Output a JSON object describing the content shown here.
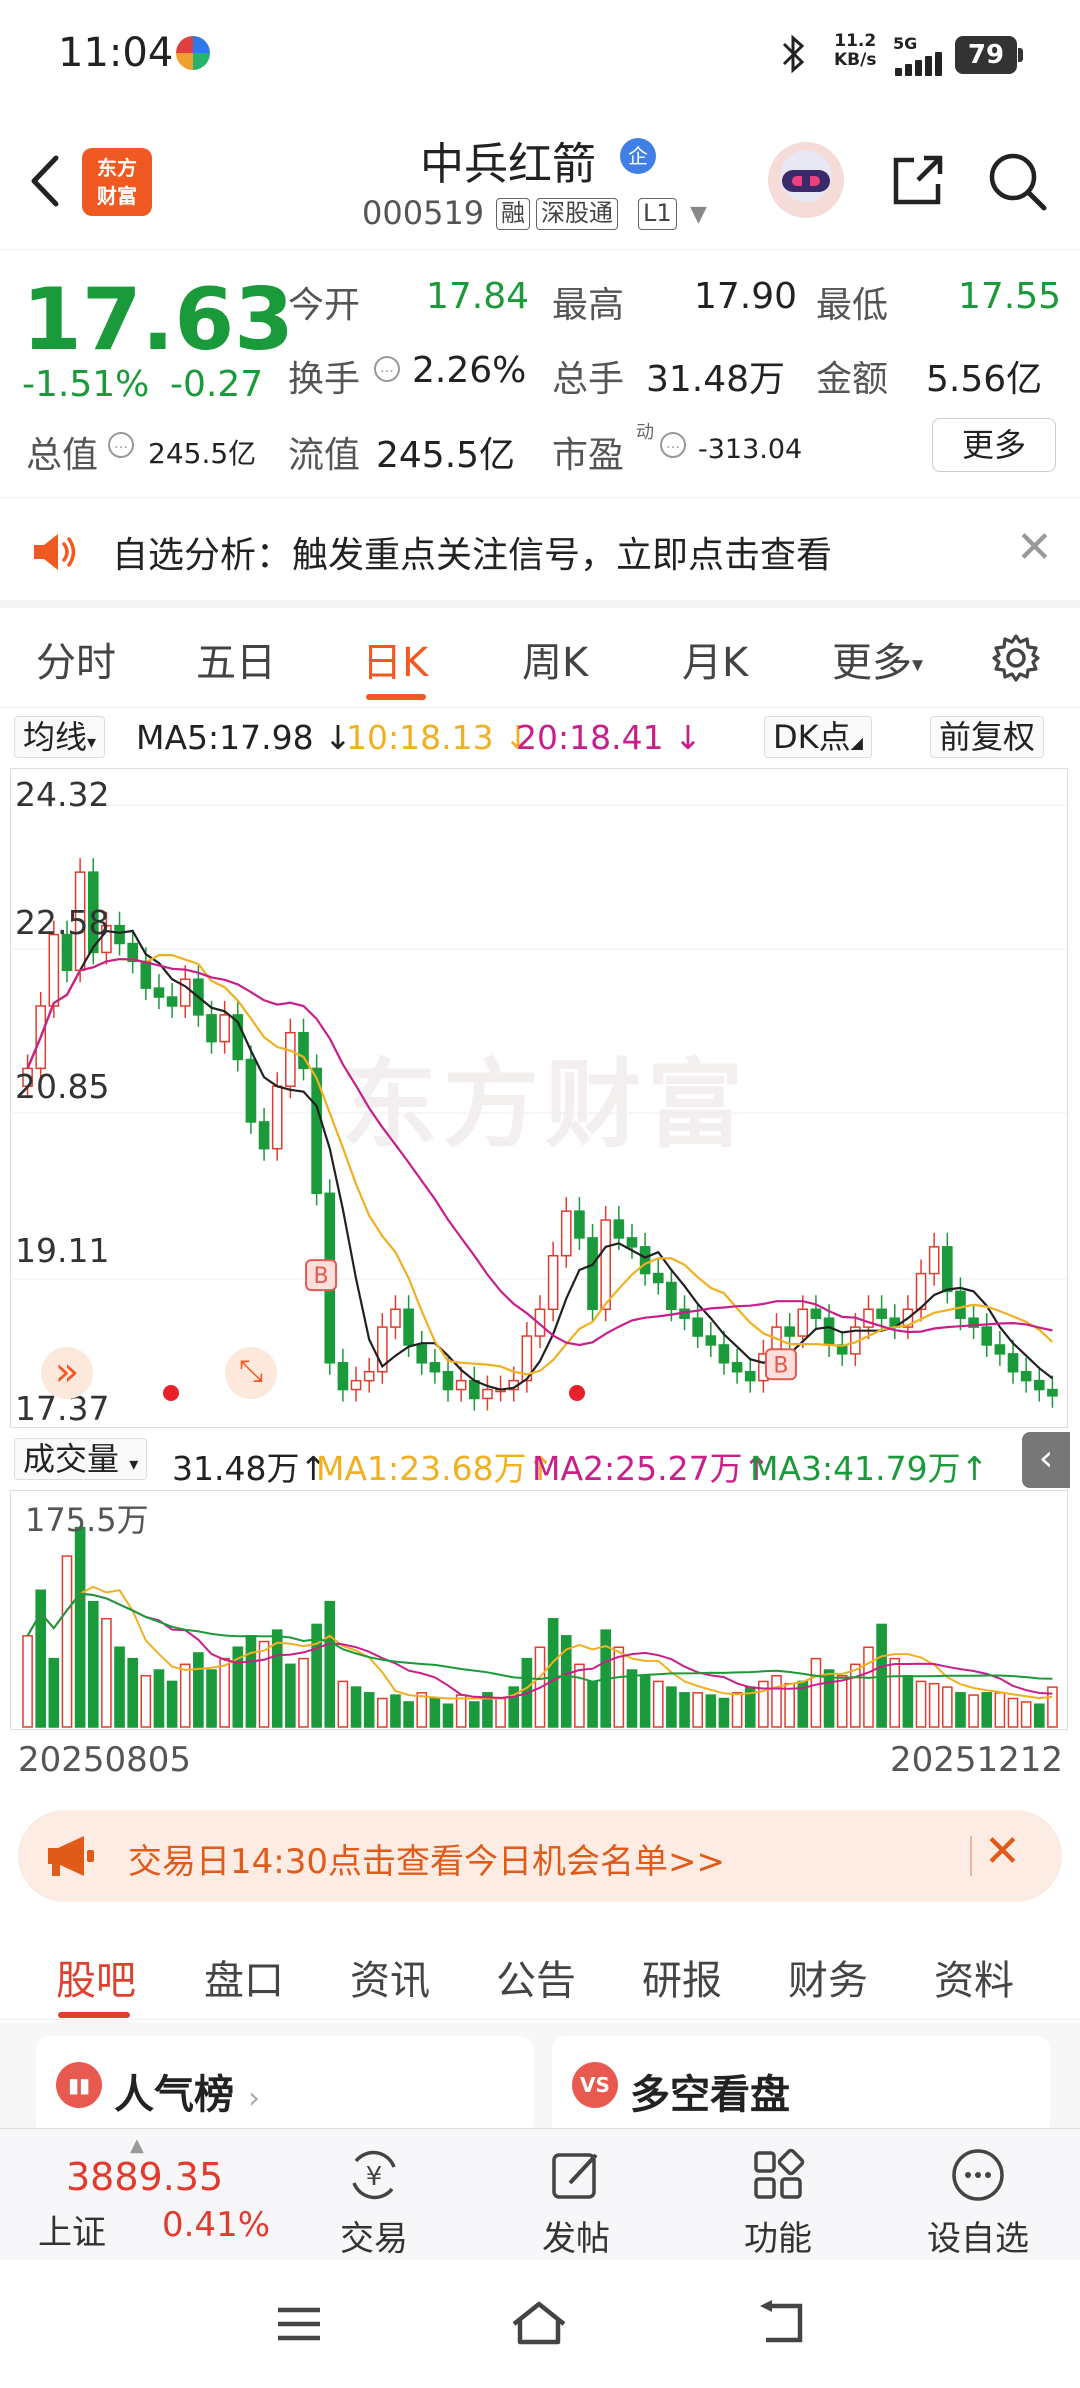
{
  "status_bar": {
    "time": "11:04",
    "network_speed_value": "11.2",
    "network_speed_unit": "KB/s",
    "network_type": "5G",
    "battery": "79",
    "icons": [
      "china-mobile-icon",
      "bluetooth-icon",
      "signal-icon",
      "battery-icon"
    ]
  },
  "header": {
    "stock_name": "中兵红箭",
    "badge": "企",
    "stock_code": "000519",
    "tags": [
      "融",
      "深股通",
      "L1"
    ],
    "logo_line1": "东方",
    "logo_line2": "财富"
  },
  "quote": {
    "price": "17.63",
    "change_pct": "-1.51%",
    "change": "-0.27",
    "open_label": "今开",
    "open": "17.84",
    "high_label": "最高",
    "high": "17.90",
    "low_label": "最低",
    "low": "17.55",
    "turnover_label": "换手",
    "turnover": "2.26%",
    "volume_label": "总手",
    "volume": "31.48万",
    "amount_label": "金额",
    "amount": "5.56亿",
    "total_mv_label": "总值",
    "total_mv": "245.5亿",
    "float_mv_label": "流值",
    "float_mv": "245.5亿",
    "pe_label": "市盈",
    "pe_superscript": "动",
    "pe": "-313.04",
    "more_label": "更多"
  },
  "alert": {
    "text": "自选分析：触发重点关注信号，立即点击查看"
  },
  "period_tabs": {
    "items": [
      "分时",
      "五日",
      "日K",
      "周K",
      "月K",
      "更多"
    ],
    "active": "日K"
  },
  "ma_bar": {
    "ma_button": "均线",
    "ma5": "MA5:17.98",
    "ma10": "10:18.13",
    "ma20": "20:18.41",
    "arrow": "↓",
    "dk_button": "DK点",
    "adjust_button": "前复权",
    "colors": {
      "ma5": "#222222",
      "ma10": "#f0b020",
      "ma20": "#c81f8a"
    }
  },
  "kline": {
    "watermark": "东方财富",
    "y_labels": [
      "24.32",
      "22.58",
      "20.85",
      "19.11",
      "17.37"
    ],
    "signal_marker": "B"
  },
  "volume": {
    "button": "成交量",
    "vol": "31.48万",
    "arrow": "↑",
    "ma1": "MA1:23.68万",
    "ma2": "MA2:25.27万",
    "ma3": "MA3:41.79万",
    "max_label": "175.5万",
    "colors": {
      "ma1": "#f0b020",
      "ma2": "#c81f8a",
      "ma3": "#1a9a3a"
    }
  },
  "dates": {
    "start": "20250805",
    "end": "20251212"
  },
  "promo": {
    "text": "交易日14:30点击查看今日机会名单>>"
  },
  "info_tabs": {
    "items": [
      "股吧",
      "盘口",
      "资讯",
      "公告",
      "研报",
      "财务",
      "资料"
    ],
    "active": "股吧"
  },
  "cards": {
    "popularity": "人气榜",
    "longshort": "多空看盘",
    "vs_icon": "VS"
  },
  "bottom_nav": {
    "index_value": "3889.35",
    "index_name": "上证",
    "index_pct": "0.41%",
    "items": [
      "交易",
      "发帖",
      "功能",
      "设自选"
    ]
  }
}
